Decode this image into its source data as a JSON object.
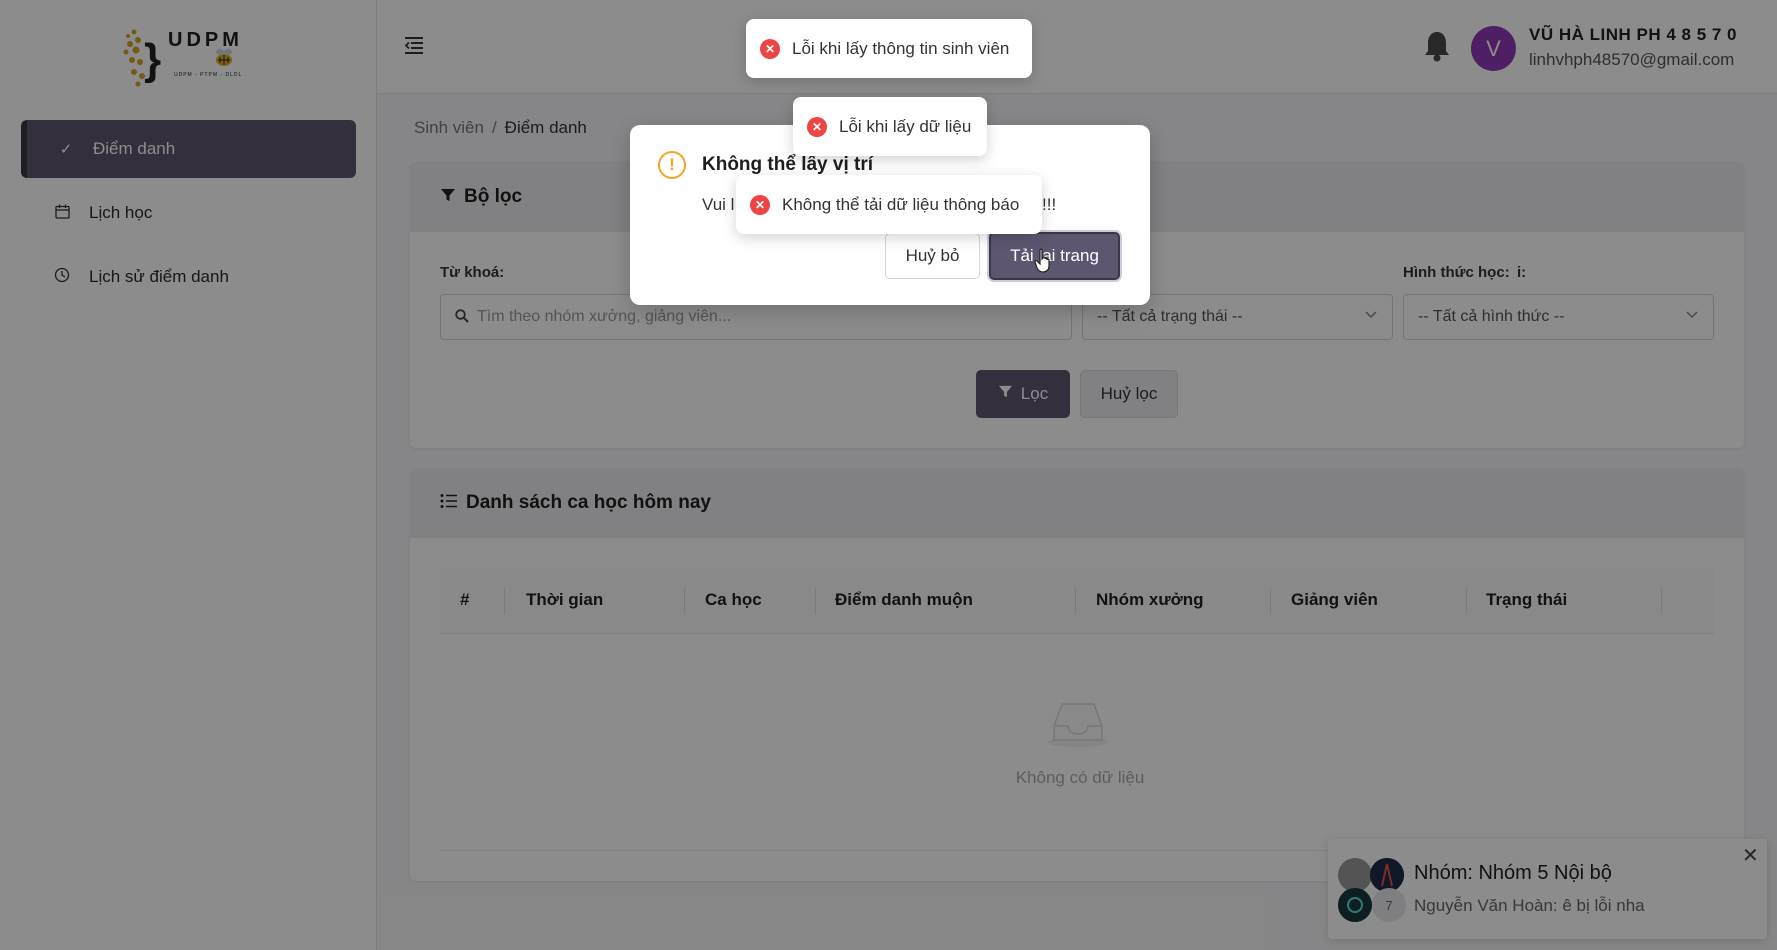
{
  "app": {
    "logo_text": "UDPM",
    "logo_subtext": "UDPM - PTPM - DLDL"
  },
  "sidebar": {
    "items": [
      {
        "label": "Điểm danh",
        "icon": "check-icon",
        "active": true
      },
      {
        "label": "Lịch học",
        "icon": "calendar-icon",
        "active": false
      },
      {
        "label": "Lịch sử điểm danh",
        "icon": "history-icon",
        "active": false
      }
    ]
  },
  "header": {
    "avatar_letter": "V",
    "user_name": "VŨ HÀ LINH PH 4 8 5 7 0",
    "user_email": "linhvhph48570@gmail.com"
  },
  "breadcrumb": {
    "parent": "Sinh viên",
    "separator": "/",
    "current": "Điểm danh"
  },
  "filter": {
    "title": "Bộ lọc",
    "keyword_label": "Từ khoá:",
    "keyword_placeholder": "Tìm theo nhóm xưởng, giảng viên...",
    "status_label_partial": "i:",
    "status_value": "-- Tất cả trạng thái --",
    "mode_label": "Hình thức học:",
    "mode_value": "-- Tất cả hình thức --",
    "filter_button": "Lọc",
    "clear_button": "Huỷ lọc"
  },
  "list": {
    "title": "Danh sách ca học hôm nay",
    "columns": [
      "#",
      "Thời gian",
      "Ca học",
      "Điểm danh muộn",
      "Nhóm xưởng",
      "Giảng viên",
      "Trạng thái"
    ],
    "empty_text": "Không có dữ liệu"
  },
  "modal": {
    "title": "Không thể lấy vị trí",
    "body_start": "Vui l",
    "body_end": "!!!",
    "cancel_button": "Huỷ bỏ",
    "reload_button": "Tải lại trang"
  },
  "toasts": [
    {
      "text": "Lỗi khi lấy thông tin sinh viên"
    },
    {
      "text": "Lỗi khi lấy dữ liệu"
    },
    {
      "text": "Không thể tải dữ liệu thông báo"
    }
  ],
  "chat": {
    "title": "Nhóm: Nhóm 5 Nội bộ",
    "message": "Nguyễn Văn Hoàn: ê bị lỗi nha",
    "member_count": "7"
  },
  "colors": {
    "primary": "#5d5670",
    "error": "#ef4444",
    "warning": "#f5a623",
    "avatar": "#8e3ab8"
  }
}
